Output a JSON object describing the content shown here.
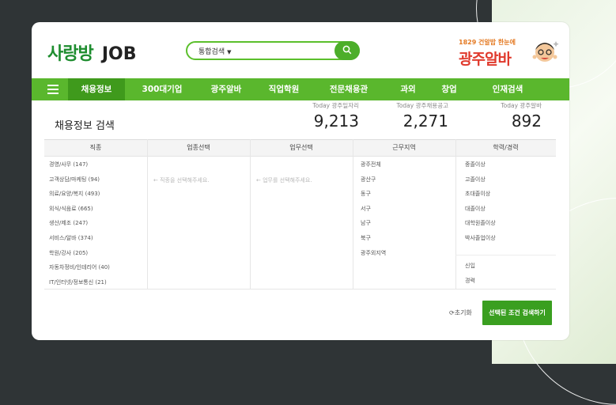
{
  "logo": {
    "korean": "사랑방",
    "english": "JOB"
  },
  "search": {
    "scope": "통합검색"
  },
  "promo": {
    "small": "1829 건알밥 한눈에",
    "big": "광주알바"
  },
  "nav": {
    "items": [
      "채용정보",
      "300대기업",
      "광주알바",
      "직업학원",
      "전문채용관",
      "과외",
      "창업",
      "인재검색"
    ]
  },
  "page": {
    "title": "채용정보 검색"
  },
  "stats": [
    {
      "label": "Today 광주일자리",
      "value": "9,213"
    },
    {
      "label": "Today 광주채용공고",
      "value": "2,271"
    },
    {
      "label": "Today 광주알바",
      "value": "892"
    }
  ],
  "table": {
    "headers": [
      "직종",
      "업종선택",
      "업무선택",
      "근무지역",
      "학력/경력"
    ],
    "jobs": [
      "경영/사무 (147)",
      "고객상담/마케팅 (94)",
      "의료/요양/복지 (493)",
      "외식/식음료 (665)",
      "생산/제조 (247)",
      "서비스/알바 (374)",
      "학원/강사 (205)",
      "자동차정비/인테리어 (40)",
      "IT/인터넷/정보통신 (21)"
    ],
    "industry_hint": "← 직종을 선택해주세요.",
    "task_hint": "← 업무를 선택해주세요.",
    "regions": [
      "광주전체",
      "광산구",
      "동구",
      "서구",
      "남구",
      "북구",
      "광주외지역"
    ],
    "education": [
      "중졸이상",
      "고졸이상",
      "초대졸이상",
      "대졸이상",
      "대학원졸이상",
      "박사졸업이상"
    ],
    "experience": [
      "신입",
      "경력"
    ]
  },
  "actions": {
    "reset": "초기화",
    "submit": "선택된 조건 검색하기"
  },
  "colors": {
    "brand_green": "#5ab72d",
    "active_tab": "#3f9a1c",
    "submit": "#3a9f20"
  }
}
